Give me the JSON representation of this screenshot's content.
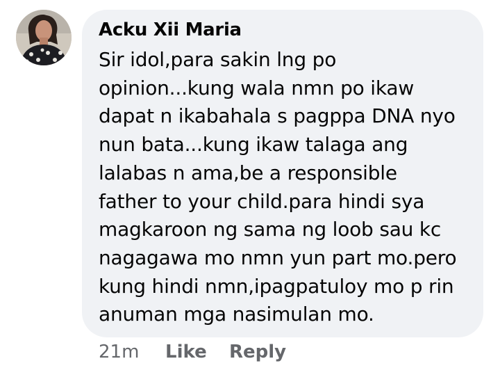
{
  "comment": {
    "author": "Acku Xii Maria",
    "text_lines": [
      "Sir idol,para sakin lng po",
      "opinion...kung wala nmn po ikaw",
      "dapat n ikabahala s pagppa DNA nyo",
      "nun bata...kung ikaw talaga ang",
      "lalabas n ama,be a responsible",
      "father to your child.para hindi sya",
      "magkaroon ng sama ng loob sau kc",
      "nagagawa mo nmn yun part mo.pero",
      "kung hindi nmn,ipagpatuloy mo p rin",
      "anuman mga nasimulan mo."
    ]
  },
  "actions": {
    "timestamp": "21m",
    "like_label": "Like",
    "reply_label": "Reply"
  },
  "colors": {
    "bubble": "#f0f2f5",
    "text": "#050505",
    "secondary_text": "#65676b"
  },
  "icons": {
    "avatar": "profile-photo"
  }
}
